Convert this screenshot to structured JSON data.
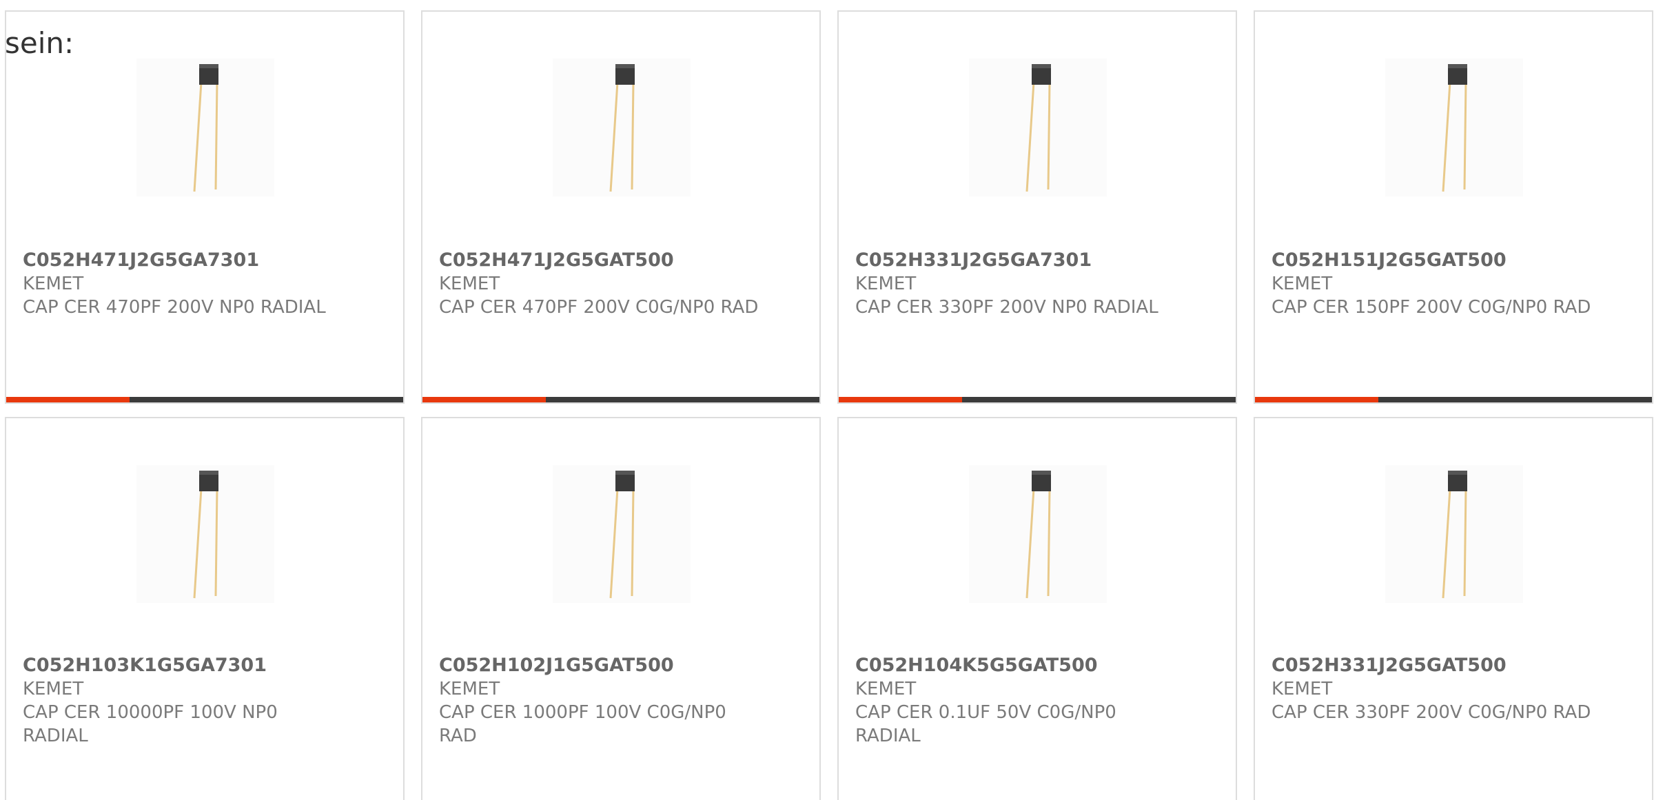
{
  "intro": {
    "text": "sein:"
  },
  "colors": {
    "accent": "#e8380d",
    "track": "#3b3b3b",
    "border": "#dddddd",
    "lead": "#e8c98a",
    "body": "#333333"
  },
  "products": [
    {
      "part_number": "C052H471J2G5GA7301",
      "manufacturer": "KEMET",
      "description": "CAP CER 470PF 200V NP0 RADIAL",
      "image_icon": "radial-capacitor-icon",
      "progress": 0.31
    },
    {
      "part_number": "C052H471J2G5GAT500",
      "manufacturer": "KEMET",
      "description": "CAP CER 470PF 200V C0G/NP0 RAD",
      "image_icon": "radial-capacitor-icon",
      "progress": 0.31
    },
    {
      "part_number": "C052H331J2G5GA7301",
      "manufacturer": "KEMET",
      "description": "CAP CER 330PF 200V NP0 RADIAL",
      "image_icon": "radial-capacitor-icon",
      "progress": 0.31
    },
    {
      "part_number": "C052H151J2G5GAT500",
      "manufacturer": "KEMET",
      "description": "CAP CER 150PF 200V C0G/NP0 RAD",
      "image_icon": "radial-capacitor-icon",
      "progress": 0.31
    },
    {
      "part_number": "C052H103K1G5GA7301",
      "manufacturer": "KEMET",
      "description": "CAP CER 10000PF 100V NP0 RADIAL",
      "image_icon": "radial-capacitor-icon"
    },
    {
      "part_number": "C052H102J1G5GAT500",
      "manufacturer": "KEMET",
      "description": "CAP CER 1000PF 100V C0G/NP0 RAD",
      "image_icon": "radial-capacitor-icon"
    },
    {
      "part_number": "C052H104K5G5GAT500",
      "manufacturer": "KEMET",
      "description": "CAP CER 0.1UF 50V C0G/NP0 RADIAL",
      "image_icon": "radial-capacitor-icon"
    },
    {
      "part_number": "C052H331J2G5GAT500",
      "manufacturer": "KEMET",
      "description": "CAP CER 330PF 200V C0G/NP0 RAD",
      "image_icon": "radial-capacitor-icon"
    }
  ]
}
